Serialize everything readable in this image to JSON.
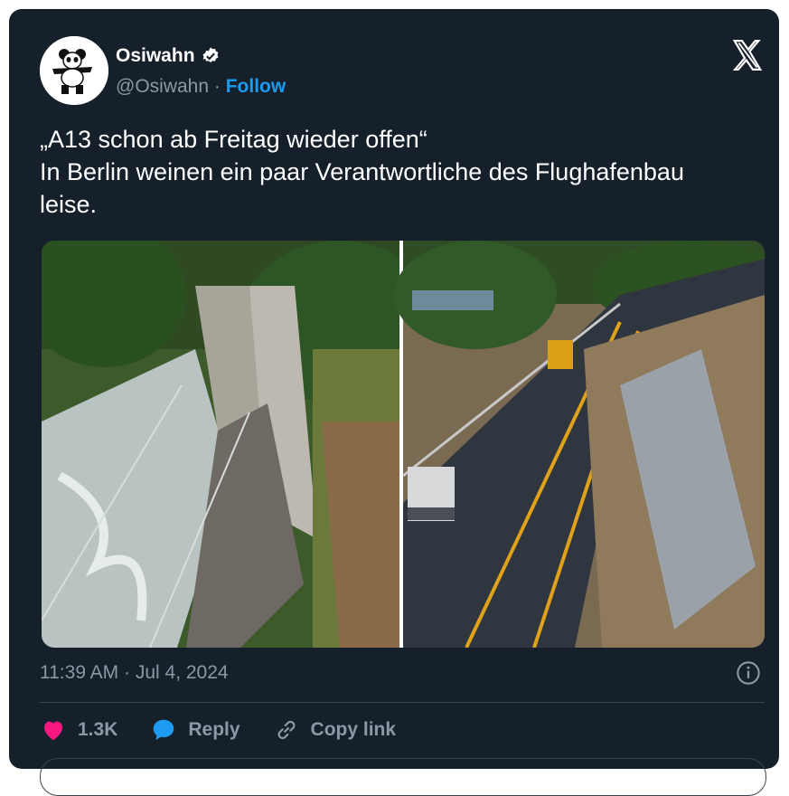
{
  "author": {
    "name": "Osiwahn",
    "handle": "@Osiwahn",
    "separator": "·",
    "follow_label": "Follow",
    "verified_color": "#ffffff"
  },
  "tweet": {
    "text": "„A13 schon ab Freitag wieder offen“\nIn Berlin weinen ein paar Verantwortliche des Flughafenbau\nleise.",
    "timestamp": "11:39 AM · Jul 4, 2024"
  },
  "media": {
    "left_image": "flood-damaged-highway-photo",
    "right_image": "repaired-highway-photo"
  },
  "actions": {
    "like_count": "1.3K",
    "reply_label": "Reply",
    "copy_label": "Copy link"
  },
  "colors": {
    "background": "#15202b",
    "accent": "#1d9bf0",
    "like": "#f91880",
    "muted": "#8b98a5"
  },
  "icons": [
    "panda-avatar",
    "verified-badge-icon",
    "x-logo-icon",
    "info-icon",
    "heart-icon",
    "reply-bubble-icon",
    "link-icon"
  ]
}
